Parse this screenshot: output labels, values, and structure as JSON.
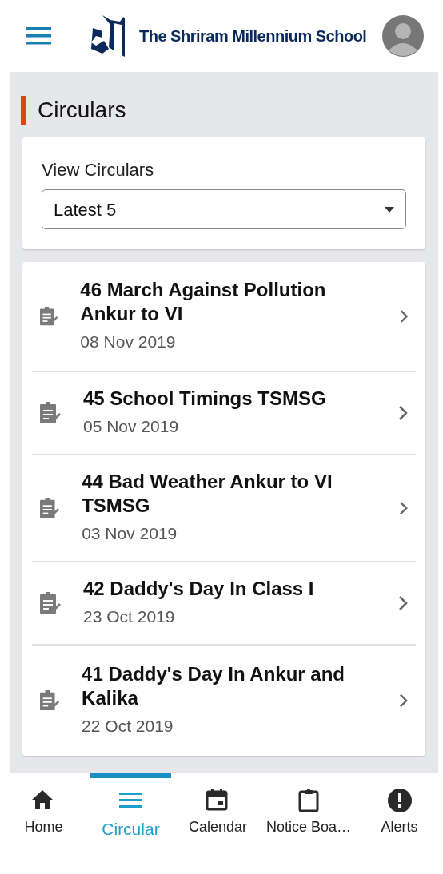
{
  "header": {
    "school_name": "The Shriram Millennium School"
  },
  "page_title": "Circulars",
  "filter": {
    "label": "View Circulars",
    "value": "Latest 5"
  },
  "circulars": [
    {
      "title": "46 March Against Pollution Ankur to VI",
      "date": "08 Nov 2019"
    },
    {
      "title": "45 School Timings TSMSG",
      "date": "05 Nov 2019"
    },
    {
      "title": "44 Bad Weather Ankur to VI TSMSG",
      "date": "03 Nov 2019"
    },
    {
      "title": "42 Daddy's Day In Class I",
      "date": "23 Oct 2019"
    },
    {
      "title": "41 Daddy's Day In Ankur and Kalika",
      "date": "22 Oct 2019"
    }
  ],
  "bottom_nav": [
    {
      "kind": "home",
      "label": "Home",
      "selected": false
    },
    {
      "kind": "circular",
      "label": "Circular",
      "selected": true
    },
    {
      "kind": "calendar",
      "label": "Calendar",
      "selected": false
    },
    {
      "kind": "notice",
      "label": "Notice Boa…",
      "selected": false
    },
    {
      "kind": "alerts",
      "label": "Alerts",
      "selected": false
    }
  ]
}
